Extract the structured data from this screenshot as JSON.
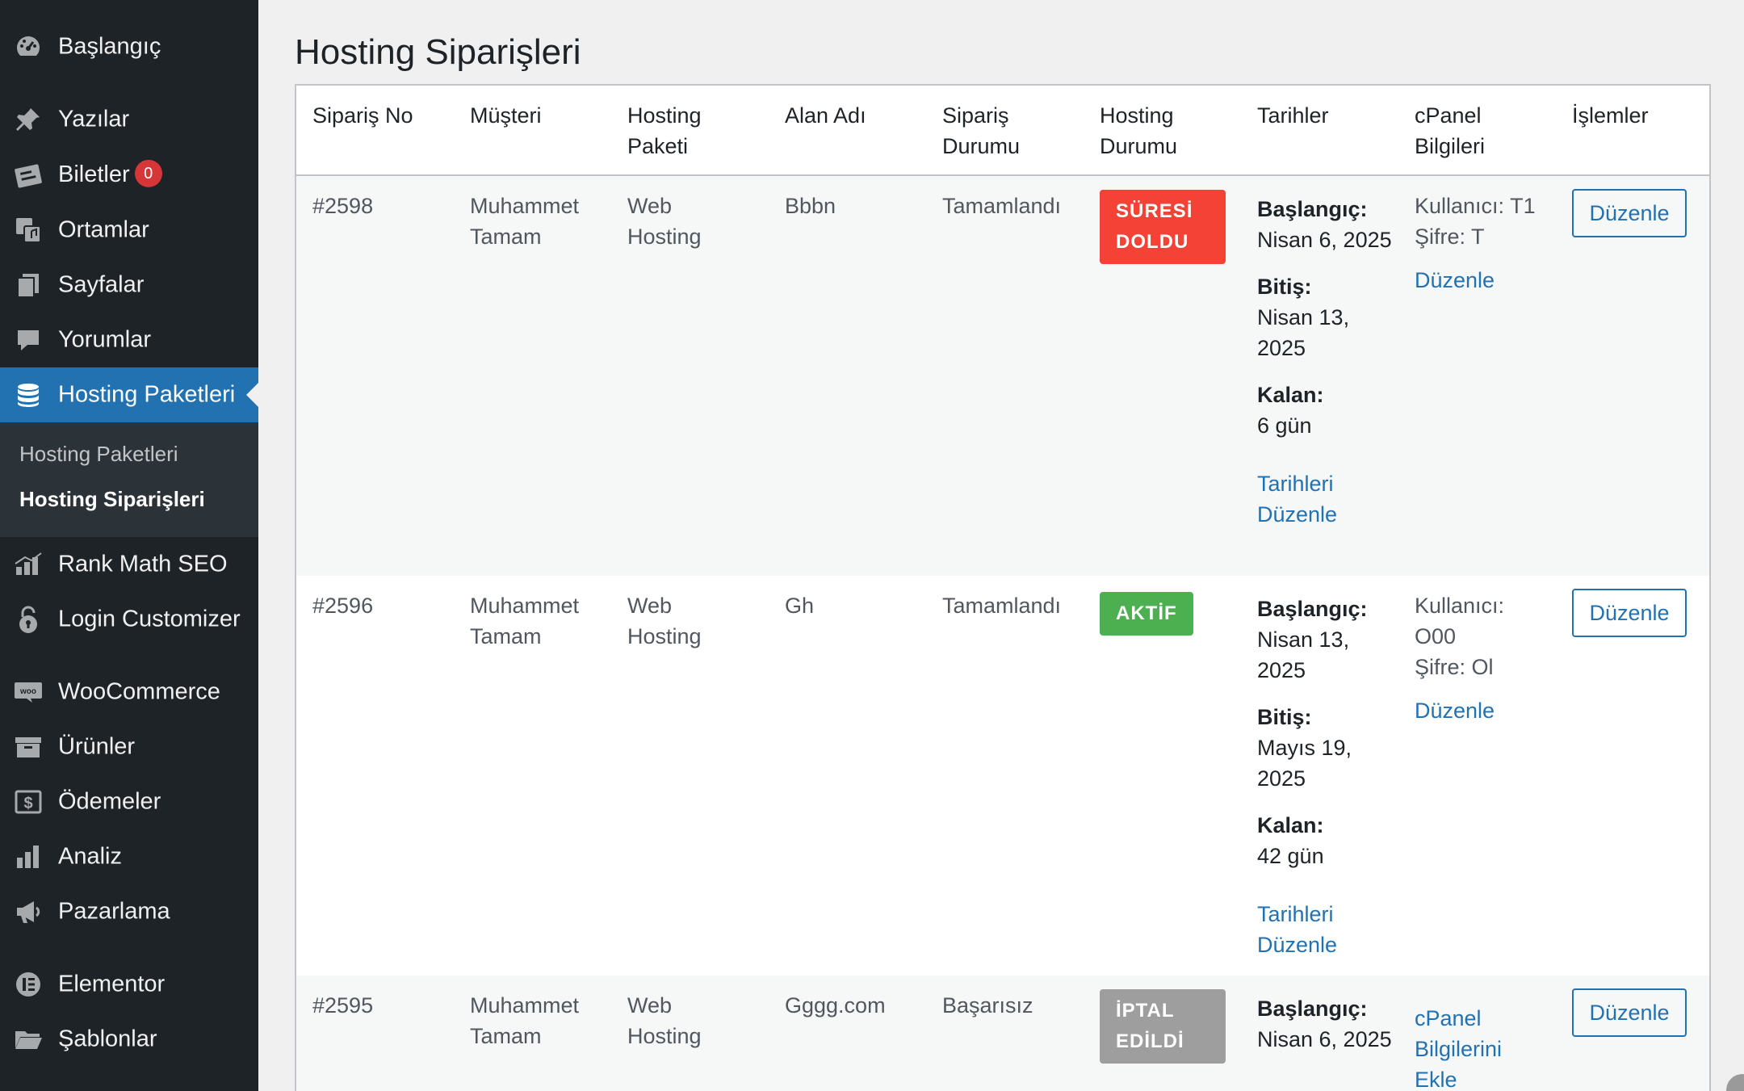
{
  "sidebar": {
    "items": [
      {
        "label": "Başlangıç",
        "icon": "dashboard-icon"
      },
      {
        "label": "Yazılar",
        "icon": "pin-icon"
      },
      {
        "label": "Biletler",
        "icon": "tickets-icon",
        "badge": "0"
      },
      {
        "label": "Ortamlar",
        "icon": "media-icon"
      },
      {
        "label": "Sayfalar",
        "icon": "pages-icon"
      },
      {
        "label": "Yorumlar",
        "icon": "comment-icon"
      },
      {
        "label": "Hosting Paketleri",
        "icon": "database-icon",
        "active": true
      },
      {
        "label": "Rank Math SEO",
        "icon": "rank-math-icon"
      },
      {
        "label": "Login Customizer",
        "icon": "lock-icon"
      },
      {
        "label": "WooCommerce",
        "icon": "woo-icon"
      },
      {
        "label": "Ürünler",
        "icon": "archive-icon"
      },
      {
        "label": "Ödemeler",
        "icon": "dollar-icon"
      },
      {
        "label": "Analiz",
        "icon": "bar-chart-icon"
      },
      {
        "label": "Pazarlama",
        "icon": "megaphone-icon"
      },
      {
        "label": "Elementor",
        "icon": "elementor-icon"
      },
      {
        "label": "Şablonlar",
        "icon": "folder-icon"
      }
    ],
    "submenu": [
      {
        "label": "Hosting Paketleri"
      },
      {
        "label": "Hosting Siparişleri",
        "current": true
      }
    ]
  },
  "page": {
    "title": "Hosting Siparişleri"
  },
  "table": {
    "headers": [
      "Sipariş No",
      "Müşteri",
      "Hosting Paketi",
      "Alan Adı",
      "Sipariş Durumu",
      "Hosting Durumu",
      "Tarihler",
      "cPanel Bilgileri",
      "İşlemler"
    ],
    "rows": [
      {
        "order_no": "#2598",
        "customer": "Muhammet Tamam",
        "package": "Web Hosting",
        "domain": "Bbbn",
        "order_status": "Tamamlandı",
        "hosting_status": "SÜRESİ DOLDU",
        "status_color": "#f44336",
        "start_label": "Başlangıç:",
        "start": "Nisan 6, 2025",
        "end_label": "Bitiş:",
        "end": "Nisan 13, 2025",
        "left_label": "Kalan:",
        "left": "6 gün",
        "dates_link": "Tarihleri Düzenle",
        "cpanel_user": "Kullanıcı: T1",
        "cpanel_pass": "Şifre: T",
        "cpanel_link": "Düzenle",
        "action": "Düzenle"
      },
      {
        "order_no": "#2596",
        "customer": "Muhammet Tamam",
        "package": "Web Hosting",
        "domain": "Gh",
        "order_status": "Tamamlandı",
        "hosting_status": "AKTİF",
        "status_color": "#4caf50",
        "start_label": "Başlangıç:",
        "start": "Nisan 13, 2025",
        "end_label": "Bitiş:",
        "end": "Mayıs 19, 2025",
        "left_label": "Kalan:",
        "left": "42 gün",
        "dates_link": "Tarihleri Düzenle",
        "cpanel_user": "Kullanıcı: O00",
        "cpanel_pass": "Şifre: Ol",
        "cpanel_link": "Düzenle",
        "action": "Düzenle"
      },
      {
        "order_no": "#2595",
        "customer": "Muhammet Tamam",
        "package": "Web Hosting",
        "domain": "Gggg.com",
        "order_status": "Başarısız",
        "hosting_status": "İPTAL EDİLDİ",
        "status_color": "#9e9e9e",
        "start_label": "Başlangıç:",
        "start": "Nisan 6, 2025",
        "cpanel_link": "cPanel Bilgilerini Ekle",
        "action": "Düzenle"
      }
    ]
  },
  "colors": {
    "sidebar_bg": "#1d2327",
    "accent": "#2271b1",
    "badge": "#d63638"
  }
}
